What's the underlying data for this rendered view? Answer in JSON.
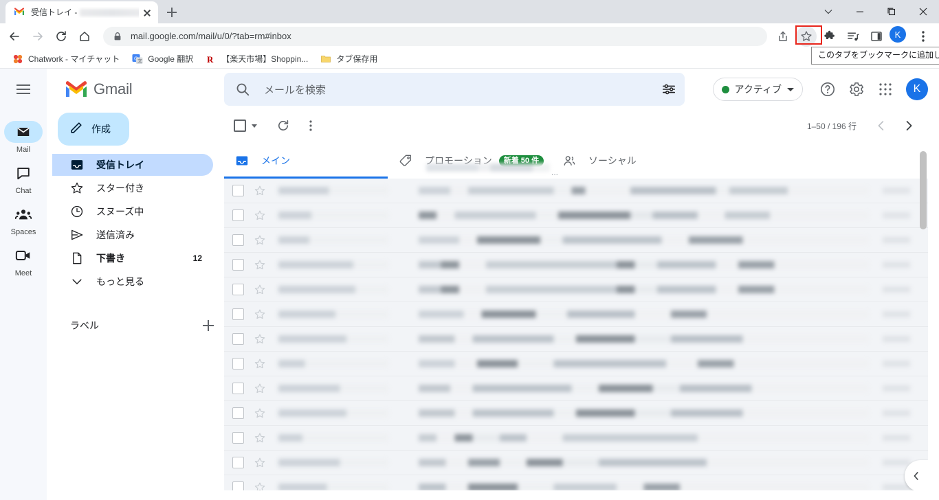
{
  "browser": {
    "tab": {
      "title": "受信トレイ -",
      "title_blurred_suffix": "@gm",
      "favicon": "gmail-icon"
    },
    "new_tab_label": "+",
    "window_controls": [
      "chevron-down-icon",
      "minimize-icon",
      "maximize-icon",
      "close-icon"
    ],
    "nav": {
      "back": "back-icon",
      "forward": "forward-icon",
      "reload": "reload-icon",
      "home": "home-icon"
    },
    "omnibox": {
      "url": "mail.google.com/mail/u/0/?tab=rm#inbox",
      "lock": "lock-icon"
    },
    "toolbar_icons": [
      "share-icon",
      "bookmark-star-icon",
      "extensions-icon",
      "reading-list-icon",
      "side-panel-icon"
    ],
    "profile_initial": "K",
    "tooltip": "このタブをブックマークに追加します",
    "bookmarks": [
      {
        "label": "Chatwork - マイチャット",
        "icon": "chatwork-icon"
      },
      {
        "label": "Google 翻訳",
        "icon": "translate-icon"
      },
      {
        "label": "【楽天市場】Shoppin...",
        "icon": "rakuten-icon"
      },
      {
        "label": "タブ保存用",
        "icon": "folder-icon"
      }
    ]
  },
  "gmail": {
    "rail": [
      {
        "label": "Mail",
        "icon": "mail-icon",
        "active": true
      },
      {
        "label": "Chat",
        "icon": "chat-icon",
        "active": false
      },
      {
        "label": "Spaces",
        "icon": "spaces-icon",
        "active": false
      },
      {
        "label": "Meet",
        "icon": "meet-icon",
        "active": false
      }
    ],
    "logo_text": "Gmail",
    "compose_label": "作成",
    "nav_items": [
      {
        "label": "受信トレイ",
        "icon": "inbox-icon",
        "count": "",
        "active": true
      },
      {
        "label": "スター付き",
        "icon": "star-icon",
        "count": "",
        "active": false
      },
      {
        "label": "スヌーズ中",
        "icon": "clock-icon",
        "count": "",
        "active": false
      },
      {
        "label": "送信済み",
        "icon": "send-icon",
        "count": "",
        "active": false
      },
      {
        "label": "下書き",
        "icon": "draft-icon",
        "count": "12",
        "active": false
      },
      {
        "label": "もっと見る",
        "icon": "chevron-down-icon",
        "count": "",
        "active": false
      }
    ],
    "labels_title": "ラベル",
    "add_label_icon": "plus-icon",
    "search": {
      "placeholder": "メールを検索",
      "icon": "search-icon",
      "options_icon": "tune-icon"
    },
    "status": {
      "text": "アクティブ",
      "dot_color": "#1e8e3e"
    },
    "header_icons": [
      "help-icon",
      "settings-icon",
      "apps-grid-icon"
    ],
    "avatar_initial": "K",
    "list_toolbar": {
      "select_all_icon": "checkbox-icon",
      "refresh_icon": "refresh-icon",
      "more_icon": "more-vertical-icon",
      "pager_text": "1–50 / 196 行",
      "prev_icon": "chevron-left-icon",
      "next_icon": "chevron-right-icon"
    },
    "tabs": [
      {
        "label": "メイン",
        "icon": "inbox-tab-icon",
        "active": true,
        "badge": ""
      },
      {
        "label": "プロモーション",
        "icon": "tag-icon",
        "active": false,
        "badge": "新着 50 件"
      },
      {
        "label": "ソーシャル",
        "icon": "people-icon",
        "active": false,
        "badge": ""
      }
    ],
    "promo_overflow": "...",
    "rows": [
      {
        "sender": "",
        "subject": "",
        "date": ""
      },
      {
        "sender": "",
        "subject": "",
        "date": ""
      },
      {
        "sender": "",
        "subject": "",
        "date": ""
      },
      {
        "sender": "",
        "subject": "",
        "date": ""
      },
      {
        "sender": "",
        "subject": "",
        "date": ""
      },
      {
        "sender": "",
        "subject": "",
        "date": ""
      },
      {
        "sender": "",
        "subject": "",
        "date": ""
      },
      {
        "sender": "",
        "subject": "",
        "date": ""
      },
      {
        "sender": "",
        "subject": "",
        "date": ""
      },
      {
        "sender": "",
        "subject": "",
        "date": ""
      },
      {
        "sender": "",
        "subject": "",
        "date": ""
      },
      {
        "sender": "",
        "subject": "",
        "date": ""
      }
    ],
    "side_expand_icon": "chevron-left-icon"
  },
  "colors": {
    "accent": "#1a73e8",
    "badge_green": "#1e8e3e",
    "highlight_red": "#e8261c",
    "inbox_pill": "#c2dbff",
    "compose_pill": "#c2e7ff"
  }
}
